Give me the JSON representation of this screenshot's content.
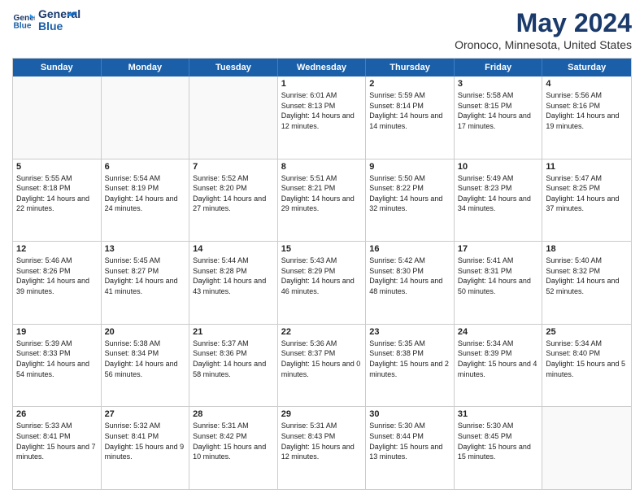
{
  "logo": {
    "line1": "General",
    "line2": "Blue"
  },
  "title": "May 2024",
  "subtitle": "Oronoco, Minnesota, United States",
  "weekdays": [
    "Sunday",
    "Monday",
    "Tuesday",
    "Wednesday",
    "Thursday",
    "Friday",
    "Saturday"
  ],
  "rows": [
    [
      {
        "day": "",
        "sunrise": "",
        "sunset": "",
        "daylight": ""
      },
      {
        "day": "",
        "sunrise": "",
        "sunset": "",
        "daylight": ""
      },
      {
        "day": "",
        "sunrise": "",
        "sunset": "",
        "daylight": ""
      },
      {
        "day": "1",
        "sunrise": "Sunrise: 6:01 AM",
        "sunset": "Sunset: 8:13 PM",
        "daylight": "Daylight: 14 hours and 12 minutes."
      },
      {
        "day": "2",
        "sunrise": "Sunrise: 5:59 AM",
        "sunset": "Sunset: 8:14 PM",
        "daylight": "Daylight: 14 hours and 14 minutes."
      },
      {
        "day": "3",
        "sunrise": "Sunrise: 5:58 AM",
        "sunset": "Sunset: 8:15 PM",
        "daylight": "Daylight: 14 hours and 17 minutes."
      },
      {
        "day": "4",
        "sunrise": "Sunrise: 5:56 AM",
        "sunset": "Sunset: 8:16 PM",
        "daylight": "Daylight: 14 hours and 19 minutes."
      }
    ],
    [
      {
        "day": "5",
        "sunrise": "Sunrise: 5:55 AM",
        "sunset": "Sunset: 8:18 PM",
        "daylight": "Daylight: 14 hours and 22 minutes."
      },
      {
        "day": "6",
        "sunrise": "Sunrise: 5:54 AM",
        "sunset": "Sunset: 8:19 PM",
        "daylight": "Daylight: 14 hours and 24 minutes."
      },
      {
        "day": "7",
        "sunrise": "Sunrise: 5:52 AM",
        "sunset": "Sunset: 8:20 PM",
        "daylight": "Daylight: 14 hours and 27 minutes."
      },
      {
        "day": "8",
        "sunrise": "Sunrise: 5:51 AM",
        "sunset": "Sunset: 8:21 PM",
        "daylight": "Daylight: 14 hours and 29 minutes."
      },
      {
        "day": "9",
        "sunrise": "Sunrise: 5:50 AM",
        "sunset": "Sunset: 8:22 PM",
        "daylight": "Daylight: 14 hours and 32 minutes."
      },
      {
        "day": "10",
        "sunrise": "Sunrise: 5:49 AM",
        "sunset": "Sunset: 8:23 PM",
        "daylight": "Daylight: 14 hours and 34 minutes."
      },
      {
        "day": "11",
        "sunrise": "Sunrise: 5:47 AM",
        "sunset": "Sunset: 8:25 PM",
        "daylight": "Daylight: 14 hours and 37 minutes."
      }
    ],
    [
      {
        "day": "12",
        "sunrise": "Sunrise: 5:46 AM",
        "sunset": "Sunset: 8:26 PM",
        "daylight": "Daylight: 14 hours and 39 minutes."
      },
      {
        "day": "13",
        "sunrise": "Sunrise: 5:45 AM",
        "sunset": "Sunset: 8:27 PM",
        "daylight": "Daylight: 14 hours and 41 minutes."
      },
      {
        "day": "14",
        "sunrise": "Sunrise: 5:44 AM",
        "sunset": "Sunset: 8:28 PM",
        "daylight": "Daylight: 14 hours and 43 minutes."
      },
      {
        "day": "15",
        "sunrise": "Sunrise: 5:43 AM",
        "sunset": "Sunset: 8:29 PM",
        "daylight": "Daylight: 14 hours and 46 minutes."
      },
      {
        "day": "16",
        "sunrise": "Sunrise: 5:42 AM",
        "sunset": "Sunset: 8:30 PM",
        "daylight": "Daylight: 14 hours and 48 minutes."
      },
      {
        "day": "17",
        "sunrise": "Sunrise: 5:41 AM",
        "sunset": "Sunset: 8:31 PM",
        "daylight": "Daylight: 14 hours and 50 minutes."
      },
      {
        "day": "18",
        "sunrise": "Sunrise: 5:40 AM",
        "sunset": "Sunset: 8:32 PM",
        "daylight": "Daylight: 14 hours and 52 minutes."
      }
    ],
    [
      {
        "day": "19",
        "sunrise": "Sunrise: 5:39 AM",
        "sunset": "Sunset: 8:33 PM",
        "daylight": "Daylight: 14 hours and 54 minutes."
      },
      {
        "day": "20",
        "sunrise": "Sunrise: 5:38 AM",
        "sunset": "Sunset: 8:34 PM",
        "daylight": "Daylight: 14 hours and 56 minutes."
      },
      {
        "day": "21",
        "sunrise": "Sunrise: 5:37 AM",
        "sunset": "Sunset: 8:36 PM",
        "daylight": "Daylight: 14 hours and 58 minutes."
      },
      {
        "day": "22",
        "sunrise": "Sunrise: 5:36 AM",
        "sunset": "Sunset: 8:37 PM",
        "daylight": "Daylight: 15 hours and 0 minutes."
      },
      {
        "day": "23",
        "sunrise": "Sunrise: 5:35 AM",
        "sunset": "Sunset: 8:38 PM",
        "daylight": "Daylight: 15 hours and 2 minutes."
      },
      {
        "day": "24",
        "sunrise": "Sunrise: 5:34 AM",
        "sunset": "Sunset: 8:39 PM",
        "daylight": "Daylight: 15 hours and 4 minutes."
      },
      {
        "day": "25",
        "sunrise": "Sunrise: 5:34 AM",
        "sunset": "Sunset: 8:40 PM",
        "daylight": "Daylight: 15 hours and 5 minutes."
      }
    ],
    [
      {
        "day": "26",
        "sunrise": "Sunrise: 5:33 AM",
        "sunset": "Sunset: 8:41 PM",
        "daylight": "Daylight: 15 hours and 7 minutes."
      },
      {
        "day": "27",
        "sunrise": "Sunrise: 5:32 AM",
        "sunset": "Sunset: 8:41 PM",
        "daylight": "Daylight: 15 hours and 9 minutes."
      },
      {
        "day": "28",
        "sunrise": "Sunrise: 5:31 AM",
        "sunset": "Sunset: 8:42 PM",
        "daylight": "Daylight: 15 hours and 10 minutes."
      },
      {
        "day": "29",
        "sunrise": "Sunrise: 5:31 AM",
        "sunset": "Sunset: 8:43 PM",
        "daylight": "Daylight: 15 hours and 12 minutes."
      },
      {
        "day": "30",
        "sunrise": "Sunrise: 5:30 AM",
        "sunset": "Sunset: 8:44 PM",
        "daylight": "Daylight: 15 hours and 13 minutes."
      },
      {
        "day": "31",
        "sunrise": "Sunrise: 5:30 AM",
        "sunset": "Sunset: 8:45 PM",
        "daylight": "Daylight: 15 hours and 15 minutes."
      },
      {
        "day": "",
        "sunrise": "",
        "sunset": "",
        "daylight": ""
      }
    ]
  ]
}
